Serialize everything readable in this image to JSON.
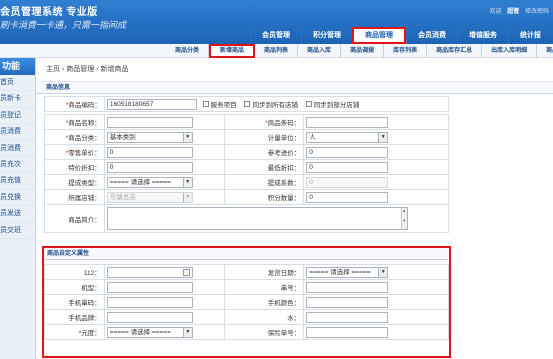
{
  "header": {
    "title": "会员管理系统 专业版",
    "slogan": "刷卡消费一卡通，只需一指间成",
    "top_links": {
      "welcome": "欢迎",
      "user": "超管",
      "logout": "修改密码"
    },
    "nav": [
      {
        "label": "会员管理"
      },
      {
        "label": "积分管理"
      },
      {
        "label": "商品管理"
      },
      {
        "label": "会员消费"
      },
      {
        "label": "增值服务"
      },
      {
        "label": "统计报"
      }
    ]
  },
  "subnav": [
    {
      "label": "商品分类"
    },
    {
      "label": "新增商品"
    },
    {
      "label": "商品列表"
    },
    {
      "label": "商品入库"
    },
    {
      "label": "商品调拨"
    },
    {
      "label": "库存列表"
    },
    {
      "label": "商品库存汇总"
    },
    {
      "label": "出库入库明细"
    },
    {
      "label": "商品"
    }
  ],
  "sidebar": {
    "title": "功能",
    "items": [
      "首页",
      "员新卡",
      "员登记",
      "员消费",
      "员消费",
      "员充次",
      "员充值",
      "员兑换",
      "员发送",
      "员交班"
    ]
  },
  "breadcrumb": "主页 › 商品管理 › 新增商品",
  "sections": {
    "info": "商品信息",
    "custom": "商品自定义属性"
  },
  "form": {
    "code_label": "商品编码：",
    "code_value": "160518180657",
    "service_label": "服务项目",
    "sync_all_label": "同步到所有店铺",
    "sync_part_label": "同步到部分店铺",
    "name_label": "商品名称：",
    "barcode_label": "商品条码：",
    "category_label": "商品分类：",
    "category_value": "基本类别",
    "unit_label": "计量单位：",
    "unit_value": "人",
    "price_label": "零售单价：",
    "price_value": "0",
    "ref_price_label": "参考进价：",
    "ref_price_value": "0",
    "special_price_label": "特价折扣：",
    "special_price_value": "0",
    "min_discount_label": "最低折扣：",
    "min_discount_value": "0",
    "commission_type_label": "提成类型：",
    "commission_type_value": "===== 请选择 =====",
    "commission_ratio_label": "提成系数：",
    "commission_ratio_value": "0",
    "shop_label": "所属店铺：",
    "shop_value": "东塘总店",
    "points_label": "积分数量：",
    "points_value": "0",
    "desc_label": "商品简介："
  },
  "custom": {
    "f112_label": "112：",
    "ship_date_label": "发货日期：",
    "ship_date_value": "===== 请选择 =====",
    "model_label": "机型：",
    "serial_label": "串号：",
    "phone_serial_label": "手机串码：",
    "phone_color_label": "手机颜色：",
    "phone_brand_label": "手机品牌：",
    "water_label": "水：",
    "charge_label": "*元度：",
    "charge_value": "===== 请选择 =====",
    "warranty_label": "保险单号："
  }
}
